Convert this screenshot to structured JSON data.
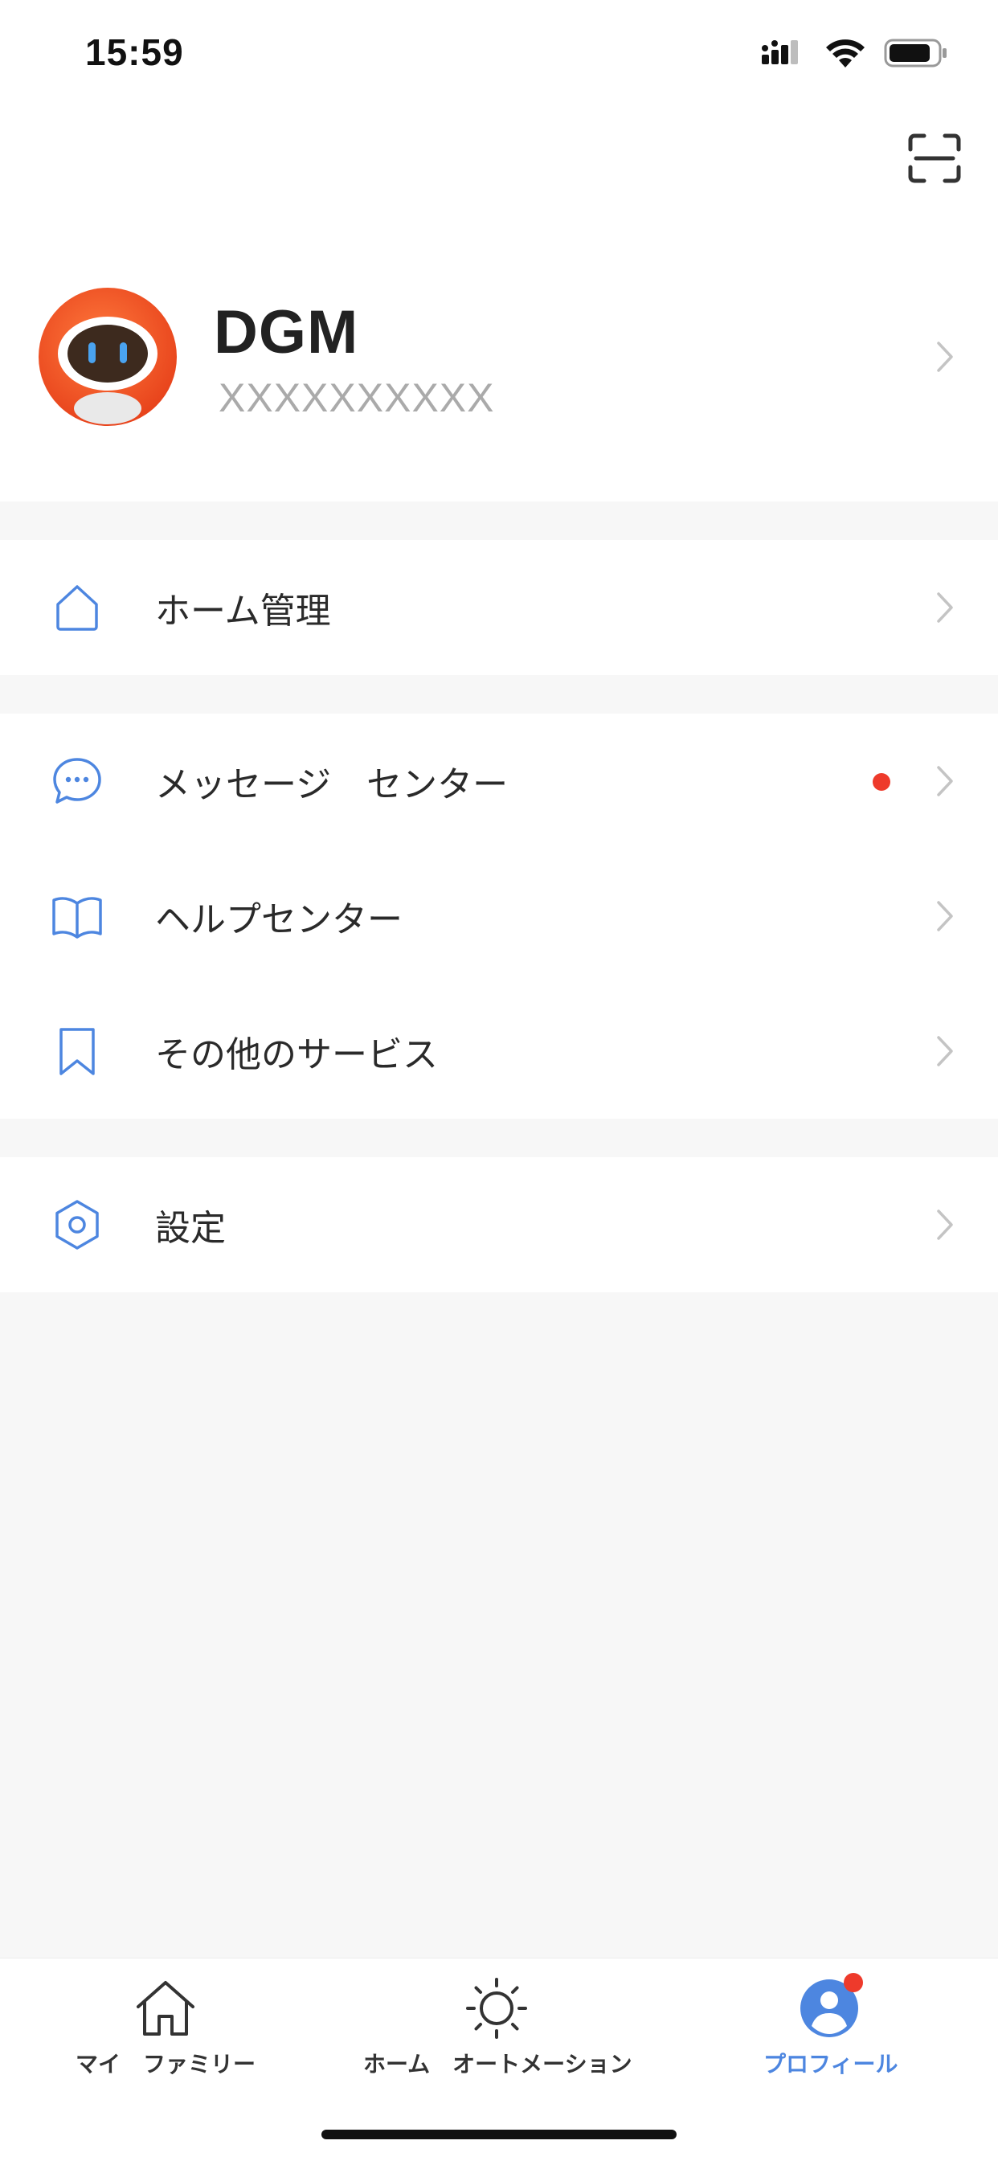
{
  "status_bar": {
    "time": "15:59",
    "icons": [
      "signal-icon",
      "wifi-icon",
      "battery-icon"
    ]
  },
  "header": {
    "scan_icon": "scan-icon"
  },
  "profile": {
    "name": "DGM",
    "account": "XXXXXXXXXX",
    "avatar_icon": "robot-avatar"
  },
  "menu": {
    "group1": [
      {
        "label": "ホーム管理",
        "icon": "house-icon"
      }
    ],
    "group2": [
      {
        "label": "メッセージ　センター",
        "icon": "chat-bubble-icon",
        "badge": true
      },
      {
        "label": "ヘルプセンター",
        "icon": "book-icon"
      },
      {
        "label": "その他のサービス",
        "icon": "bookmark-icon"
      }
    ],
    "group3": [
      {
        "label": "設定",
        "icon": "hexagon-settings-icon"
      }
    ]
  },
  "tab_bar": {
    "tabs": [
      {
        "label": "マイ　ファミリー",
        "icon": "house-icon",
        "active": false
      },
      {
        "label": "ホーム　オートメーション",
        "icon": "sun-icon",
        "active": false
      },
      {
        "label": "プロフィール",
        "icon": "user-icon",
        "active": true,
        "badge": true
      }
    ]
  },
  "colors": {
    "accent": "#4d86e0",
    "badge": "#ee3a2b",
    "background": "#f7f7f7",
    "avatar_orange": "#f2562a"
  }
}
